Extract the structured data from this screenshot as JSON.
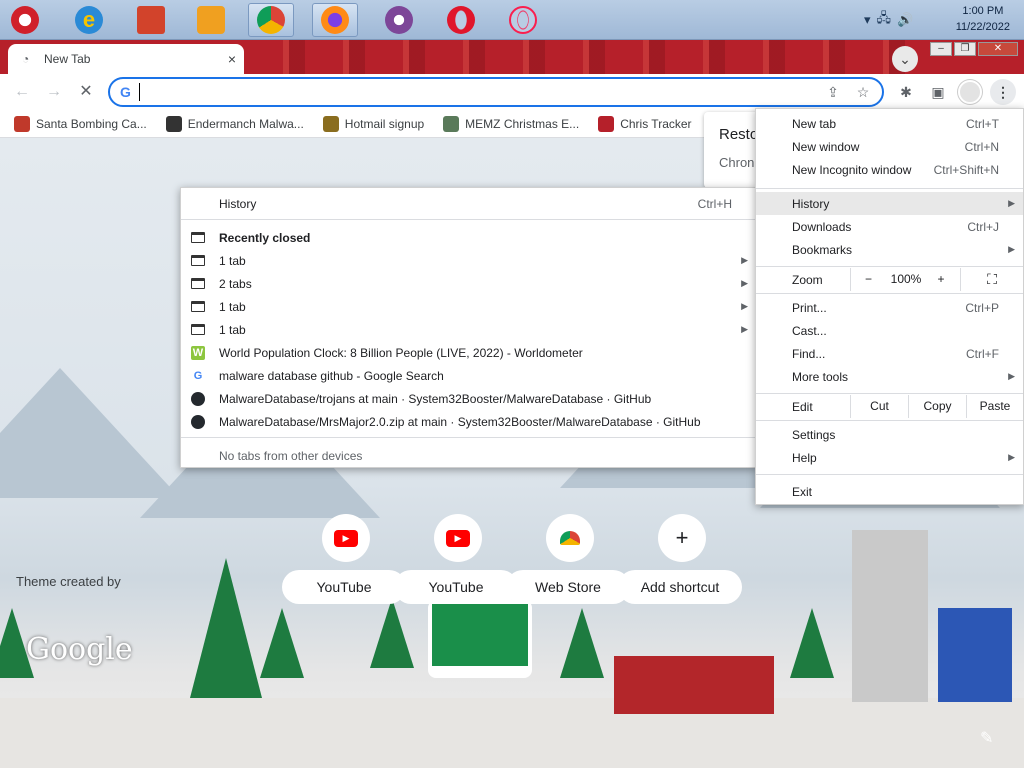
{
  "taskbar": {
    "clock_time": "1:00 PM",
    "clock_date": "11/22/2022",
    "icons": [
      "santa-app-icon",
      "internet-explorer-icon",
      "file-explorer-icon",
      "media-player-icon",
      "chrome-icon",
      "firefox-icon",
      "tor-browser-icon",
      "opera-icon",
      "opera-gx-icon"
    ]
  },
  "browser": {
    "tab_title": "New Tab",
    "tab_close": "×",
    "newtab_chevron": "⌄"
  },
  "toolbar": {
    "omnibox_value": "",
    "omnibox_g": "G"
  },
  "bookmarks": [
    {
      "label": "Santa Bombing Ca...",
      "color": "#c0392b"
    },
    {
      "label": "Endermanch Malwa...",
      "color": "#333333"
    },
    {
      "label": "Hotmail signup",
      "color": "#8a6d1f"
    },
    {
      "label": "MEMZ Christmas E...",
      "color": "#5a7a5a"
    },
    {
      "label": "Chris Tracker",
      "color": "#b5202a"
    }
  ],
  "restore_popup": {
    "title": "Resto",
    "body": "Chron"
  },
  "history_menu": {
    "header": "History",
    "header_shortcut": "Ctrl+H",
    "recently_closed": "Recently closed",
    "closed_items": [
      "1 tab",
      "2 tabs",
      "1 tab",
      "1 tab"
    ],
    "pages": [
      {
        "title": "World Population Clock: 8 Billion People (LIVE, 2022) - Worldometer",
        "icon": "worldometer-icon"
      },
      {
        "title": "malware database github - Google Search",
        "icon": "google-icon"
      },
      {
        "title": "MalwareDatabase/trojans at main · System32Booster/MalwareDatabase · GitHub",
        "icon": "github-icon"
      },
      {
        "title": "MalwareDatabase/MrsMajor2.0.zip at main · System32Booster/MalwareDatabase · GitHub",
        "icon": "github-icon"
      }
    ],
    "no_other_devices": "No tabs from other devices"
  },
  "chrome_menu": {
    "new_tab": {
      "label": "New tab",
      "shortcut": "Ctrl+T"
    },
    "new_window": {
      "label": "New window",
      "shortcut": "Ctrl+N"
    },
    "new_incognito": {
      "label": "New Incognito window",
      "shortcut": "Ctrl+Shift+N"
    },
    "history": {
      "label": "History"
    },
    "downloads": {
      "label": "Downloads",
      "shortcut": "Ctrl+J"
    },
    "bookmarks": {
      "label": "Bookmarks"
    },
    "zoom": {
      "label": "Zoom",
      "minus": "−",
      "value": "100%",
      "plus": "+"
    },
    "print": {
      "label": "Print...",
      "shortcut": "Ctrl+P"
    },
    "cast": {
      "label": "Cast..."
    },
    "find": {
      "label": "Find...",
      "shortcut": "Ctrl+F"
    },
    "more_tools": {
      "label": "More tools"
    },
    "edit": {
      "label": "Edit",
      "cut": "Cut",
      "copy": "Copy",
      "paste": "Paste"
    },
    "settings": {
      "label": "Settings"
    },
    "help": {
      "label": "Help"
    },
    "exit": {
      "label": "Exit"
    }
  },
  "ntp": {
    "theme_credit": "Theme created by",
    "google_logo": "Google",
    "shortcuts": [
      {
        "label": "YouTube",
        "icon": "youtube-icon"
      },
      {
        "label": "YouTube",
        "icon": "youtube-icon"
      },
      {
        "label": "Web Store",
        "icon": "chrome-web-store-icon"
      },
      {
        "label": "Add shortcut",
        "icon": "plus-icon"
      }
    ]
  },
  "colors": {
    "accent": "#1a73e8",
    "tabstrip": "#b6202a",
    "youtube": "#ff0000"
  }
}
